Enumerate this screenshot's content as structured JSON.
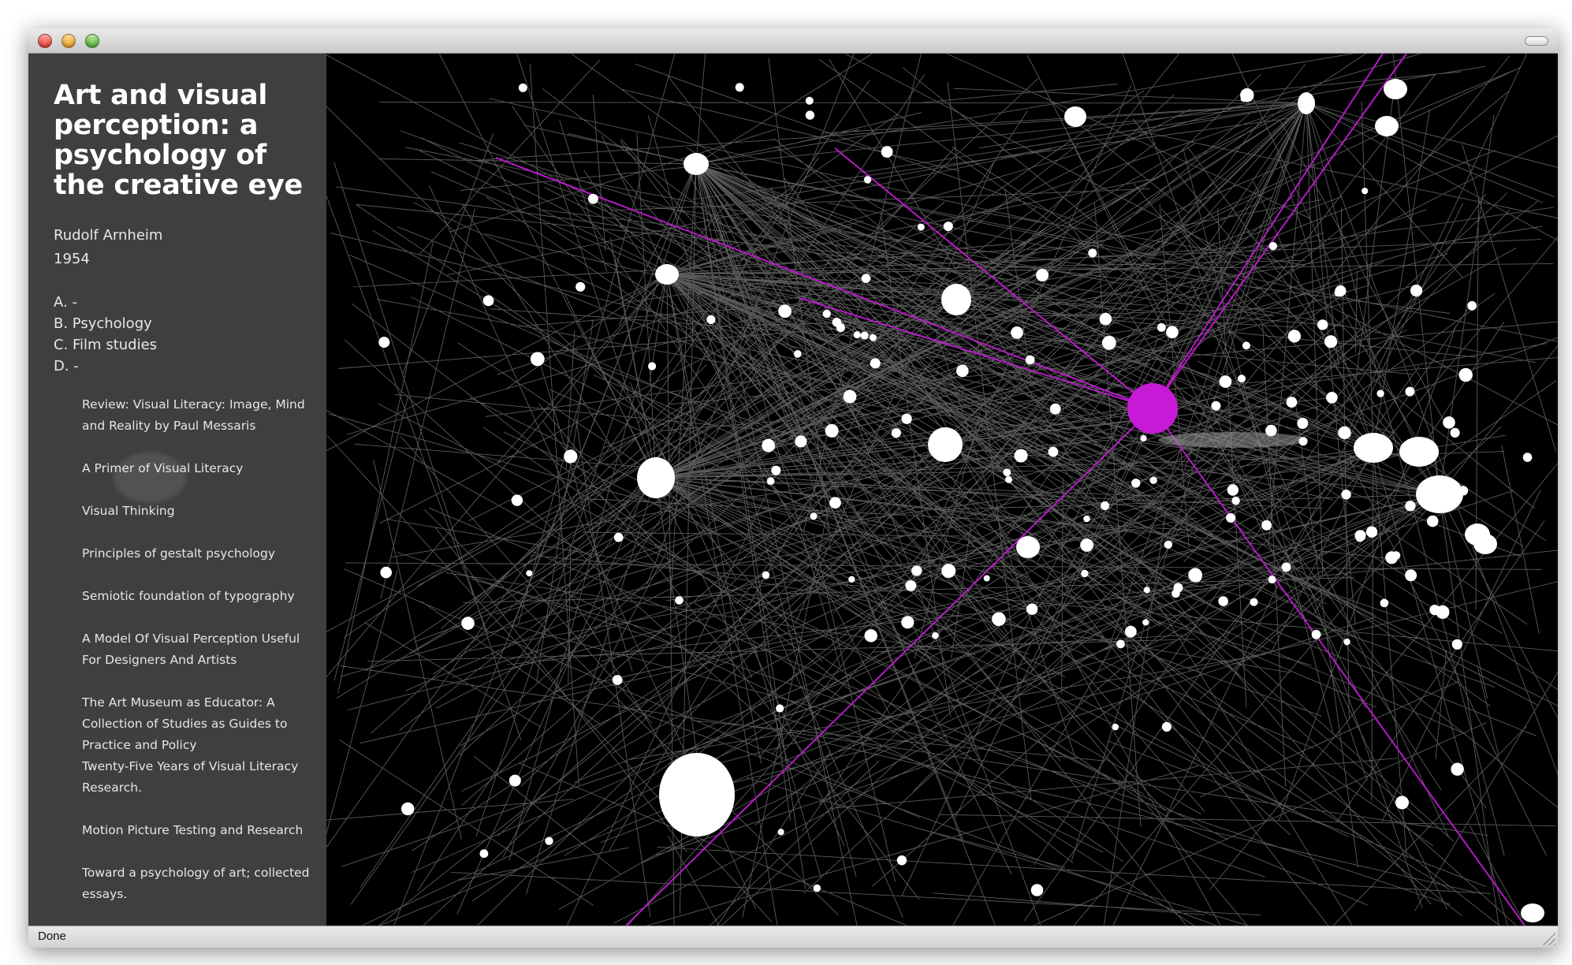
{
  "window": {
    "status": "Done"
  },
  "book": {
    "title": "Art and visual perception: a psychology of the creative eye",
    "author": "Rudolf Arnheim",
    "year": "1954",
    "categories": [
      "A. -",
      "B. Psychology",
      "C. Film studies",
      "D. -"
    ]
  },
  "related": [
    "Review: Visual Literacy: Image, Mind and Reality by Paul Messaris",
    "A Primer of Visual Literacy",
    "Visual Thinking",
    "Principles of gestalt psychology",
    "Semiotic foundation of typography",
    "A Model Of Visual Perception Useful For Designers And Artists",
    "The Art Museum as Educator: A Collection of Studies as Guides to Practice and Policy",
    "Twenty-Five Years of Visual Literacy Research.",
    "Motion Picture Testing and Research",
    "Toward a psychology of art; collected essays."
  ],
  "colors": {
    "sidebar_bg": "#3f3f3f",
    "graph_bg": "#000000",
    "node": "#ffffff",
    "edge": "#7a7a7a",
    "selected_node": "#c71ad6",
    "selected_edge": "#b51cc4"
  },
  "icons": {
    "close": "close-icon",
    "minimize": "minimize-icon",
    "zoom": "zoom-icon",
    "toolbar": "toolbar-toggle-icon",
    "resize": "resize-grip-icon"
  }
}
